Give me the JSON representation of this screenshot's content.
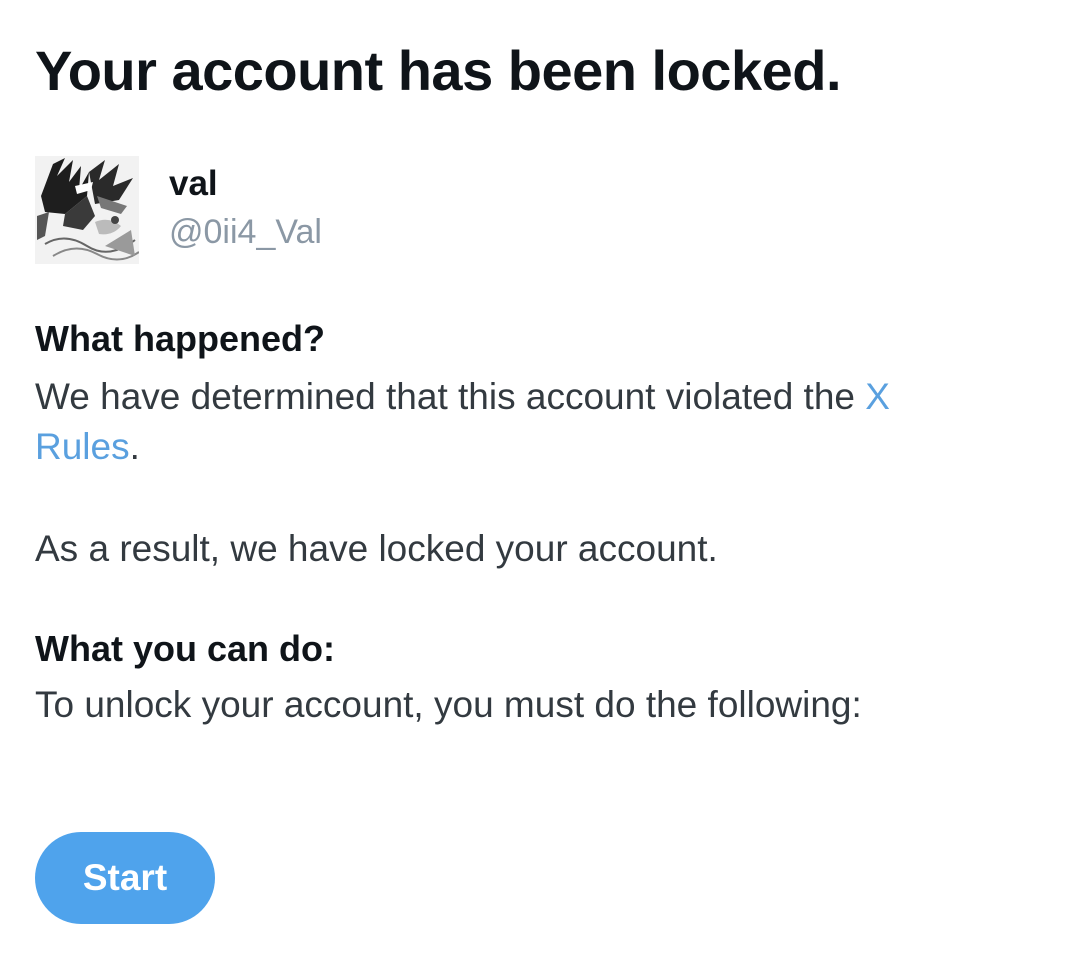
{
  "page": {
    "title": "Your account has been locked."
  },
  "profile": {
    "display_name": "val",
    "handle": "@0ii4_Val",
    "avatar_icon": "avatar-icon"
  },
  "what_happened": {
    "heading": "What happened?",
    "body_prefix": "We have determined that this account violated the ",
    "link_label": "X Rules",
    "body_suffix": ".",
    "result": "As a result, we have locked your account."
  },
  "what_you_can_do": {
    "heading": "What you can do:",
    "body": "To unlock your account, you must do the following:"
  },
  "actions": {
    "start_label": "Start"
  },
  "colors": {
    "link": "#5aa0df",
    "button": "#4fa3ec",
    "handle": "#8b98a5"
  }
}
